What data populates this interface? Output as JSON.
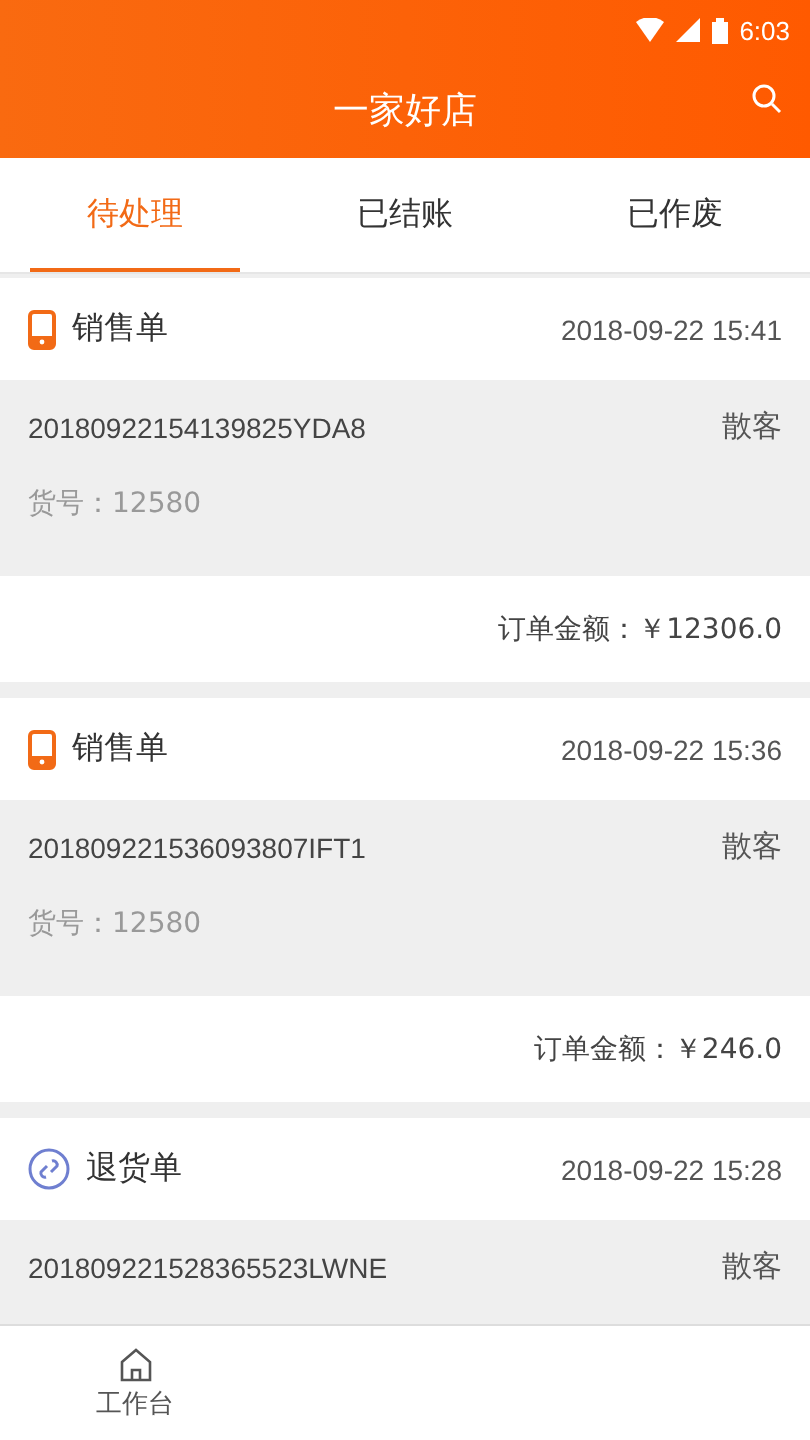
{
  "status_bar": {
    "time": "6:03"
  },
  "header": {
    "title": "一家好店"
  },
  "tabs": [
    {
      "label": "待处理",
      "selected": true
    },
    {
      "label": "已结账",
      "selected": false
    },
    {
      "label": "已作废",
      "selected": false
    }
  ],
  "orders": [
    {
      "kind": "sale",
      "type": "销售单",
      "time": "2018-09-22 15:41",
      "number": "20180922154139825YDA8",
      "customer": "散客",
      "item_no": "货号：12580",
      "amount": "订单金额：￥12306.0"
    },
    {
      "kind": "sale",
      "type": "销售单",
      "time": "2018-09-22 15:36",
      "number": "201809221536093807IFT1",
      "customer": "散客",
      "item_no": "货号：12580",
      "amount": "订单金额：￥246.0"
    },
    {
      "kind": "return",
      "type": "退货单",
      "time": "2018-09-22 15:28",
      "number": "201809221528365523LWNE",
      "customer": "散客"
    }
  ],
  "bottom_nav": [
    {
      "label": "工作台"
    }
  ]
}
